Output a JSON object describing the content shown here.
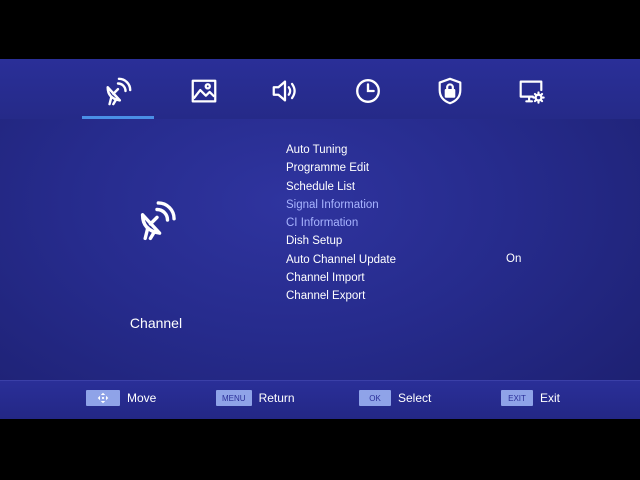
{
  "tabs": [
    {
      "icon": "satellite-dish-icon"
    },
    {
      "icon": "picture-icon"
    },
    {
      "icon": "sound-icon"
    },
    {
      "icon": "clock-icon"
    },
    {
      "icon": "lock-icon"
    },
    {
      "icon": "setup-icon"
    }
  ],
  "category": {
    "icon": "satellite-dish-icon",
    "label": "Channel"
  },
  "menu": [
    {
      "label": "Auto Tuning"
    },
    {
      "label": "Programme Edit"
    },
    {
      "label": "Schedule List"
    },
    {
      "label": "Signal Information",
      "disabled": true
    },
    {
      "label": "CI Information",
      "disabled": true
    },
    {
      "label": "Dish Setup"
    },
    {
      "label": "Auto Channel Update",
      "value": "On"
    },
    {
      "label": "Channel Import"
    },
    {
      "label": "Channel Export"
    }
  ],
  "hints": [
    {
      "key": "",
      "key_icon": "arrows-icon",
      "label": "Move"
    },
    {
      "key": "MENU",
      "label": "Return"
    },
    {
      "key": "OK",
      "label": "Select"
    },
    {
      "key": "EXIT",
      "label": "Exit"
    }
  ],
  "colors": {
    "background": "#262b8c",
    "accent": "#4a8fe6",
    "disabled_text": "#a8b4ff",
    "key_bg": "#8fa3e8"
  }
}
